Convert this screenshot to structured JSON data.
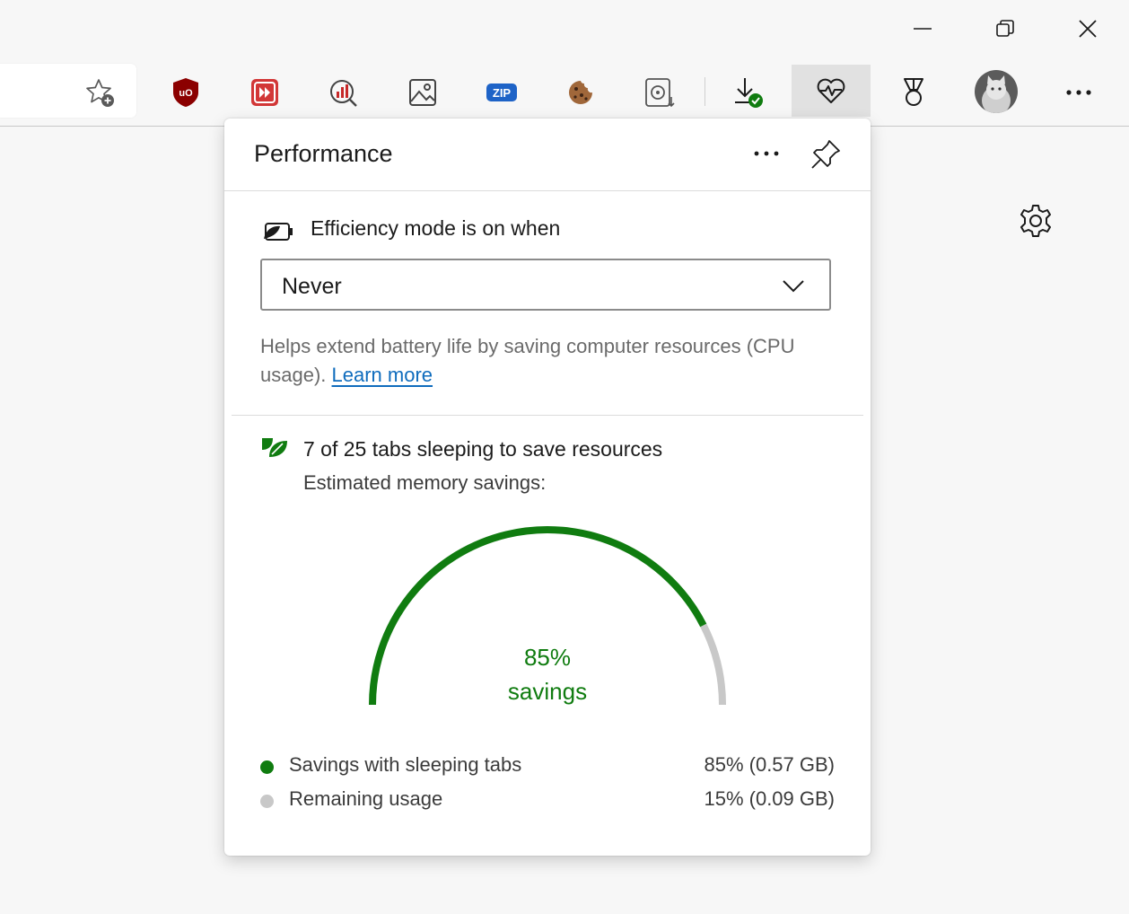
{
  "toolbar": {
    "extensions": [
      {
        "name": "ublock-origin-icon"
      },
      {
        "name": "video-speed-controller-icon"
      },
      {
        "name": "web-vitals-icon"
      },
      {
        "name": "image-search-icon"
      },
      {
        "name": "zip-extension-icon",
        "label": "ZIP"
      },
      {
        "name": "cookie-editor-icon"
      },
      {
        "name": "media-downloader-icon"
      }
    ],
    "accent": "#107c10",
    "ublock_color": "#8b0000"
  },
  "panel": {
    "title": "Performance",
    "efficiency": {
      "label": "Efficiency mode is on when",
      "selected": "Never",
      "help_text": "Helps extend battery life by saving computer resources (CPU usage).",
      "link": "Learn more"
    },
    "sleeping": {
      "title": "7 of 25 tabs sleeping to save resources",
      "subtitle": "Estimated memory savings:"
    },
    "gauge": {
      "percent_text": "85%",
      "label": "savings",
      "fraction": 0.85,
      "color_used": "#107c10",
      "color_remaining": "#c8c8c8"
    },
    "legend": [
      {
        "label": "Savings with sleeping tabs",
        "value": "85% (0.57 GB)",
        "color": "#107c10"
      },
      {
        "label": "Remaining usage",
        "value": "15% (0.09 GB)",
        "color": "#c8c8c8"
      }
    ]
  }
}
